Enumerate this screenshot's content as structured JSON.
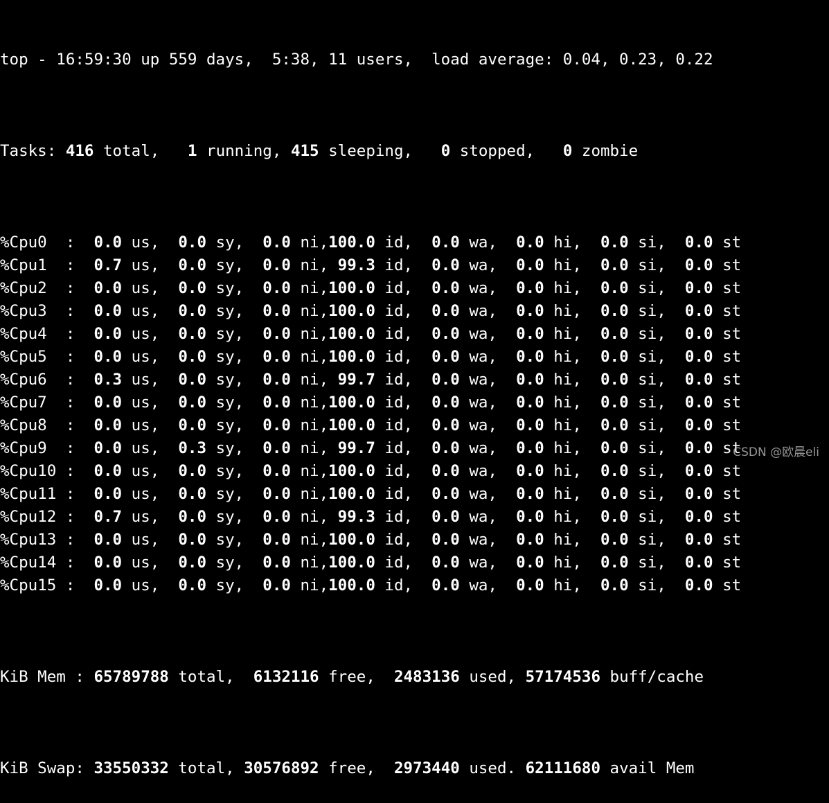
{
  "colors": {
    "background": "#000000",
    "foreground": "#ffffff"
  },
  "summary": {
    "uptime": "top - 16:59:30 up 559 days,  5:38, 11 users,  load average: 0.04, 0.23, 0.22",
    "tasks": {
      "label": "Tasks: ",
      "total": "416",
      "total_label": " total,   ",
      "running": "1",
      "running_label": " running, ",
      "sleeping": "415",
      "sleeping_label": " sleeping,   ",
      "stopped": "0",
      "stopped_label": " stopped,   ",
      "zombie": "0",
      "zombie_label": " zombie"
    }
  },
  "cpu_labels": {
    "us": " us, ",
    "sy": " sy, ",
    "ni": " ni,",
    "id": " id, ",
    "wa": " wa, ",
    "hi": " hi, ",
    "si": " si, ",
    "st": " st"
  },
  "cpus": [
    {
      "name": "%Cpu0  : ",
      "us": " 0.0",
      "sy": " 0.0",
      "ni": " 0.0",
      "id": "100.0",
      "wa": " 0.0",
      "hi": " 0.0",
      "si": " 0.0",
      "st": " 0.0"
    },
    {
      "name": "%Cpu1  : ",
      "us": " 0.7",
      "sy": " 0.0",
      "ni": " 0.0",
      "id": " 99.3",
      "wa": " 0.0",
      "hi": " 0.0",
      "si": " 0.0",
      "st": " 0.0"
    },
    {
      "name": "%Cpu2  : ",
      "us": " 0.0",
      "sy": " 0.0",
      "ni": " 0.0",
      "id": "100.0",
      "wa": " 0.0",
      "hi": " 0.0",
      "si": " 0.0",
      "st": " 0.0"
    },
    {
      "name": "%Cpu3  : ",
      "us": " 0.0",
      "sy": " 0.0",
      "ni": " 0.0",
      "id": "100.0",
      "wa": " 0.0",
      "hi": " 0.0",
      "si": " 0.0",
      "st": " 0.0"
    },
    {
      "name": "%Cpu4  : ",
      "us": " 0.0",
      "sy": " 0.0",
      "ni": " 0.0",
      "id": "100.0",
      "wa": " 0.0",
      "hi": " 0.0",
      "si": " 0.0",
      "st": " 0.0"
    },
    {
      "name": "%Cpu5  : ",
      "us": " 0.0",
      "sy": " 0.0",
      "ni": " 0.0",
      "id": "100.0",
      "wa": " 0.0",
      "hi": " 0.0",
      "si": " 0.0",
      "st": " 0.0"
    },
    {
      "name": "%Cpu6  : ",
      "us": " 0.3",
      "sy": " 0.0",
      "ni": " 0.0",
      "id": " 99.7",
      "wa": " 0.0",
      "hi": " 0.0",
      "si": " 0.0",
      "st": " 0.0"
    },
    {
      "name": "%Cpu7  : ",
      "us": " 0.0",
      "sy": " 0.0",
      "ni": " 0.0",
      "id": "100.0",
      "wa": " 0.0",
      "hi": " 0.0",
      "si": " 0.0",
      "st": " 0.0"
    },
    {
      "name": "%Cpu8  : ",
      "us": " 0.0",
      "sy": " 0.0",
      "ni": " 0.0",
      "id": "100.0",
      "wa": " 0.0",
      "hi": " 0.0",
      "si": " 0.0",
      "st": " 0.0"
    },
    {
      "name": "%Cpu9  : ",
      "us": " 0.0",
      "sy": " 0.3",
      "ni": " 0.0",
      "id": " 99.7",
      "wa": " 0.0",
      "hi": " 0.0",
      "si": " 0.0",
      "st": " 0.0"
    },
    {
      "name": "%Cpu10 : ",
      "us": " 0.0",
      "sy": " 0.0",
      "ni": " 0.0",
      "id": "100.0",
      "wa": " 0.0",
      "hi": " 0.0",
      "si": " 0.0",
      "st": " 0.0"
    },
    {
      "name": "%Cpu11 : ",
      "us": " 0.0",
      "sy": " 0.0",
      "ni": " 0.0",
      "id": "100.0",
      "wa": " 0.0",
      "hi": " 0.0",
      "si": " 0.0",
      "st": " 0.0"
    },
    {
      "name": "%Cpu12 : ",
      "us": " 0.7",
      "sy": " 0.0",
      "ni": " 0.0",
      "id": " 99.3",
      "wa": " 0.0",
      "hi": " 0.0",
      "si": " 0.0",
      "st": " 0.0"
    },
    {
      "name": "%Cpu13 : ",
      "us": " 0.0",
      "sy": " 0.0",
      "ni": " 0.0",
      "id": "100.0",
      "wa": " 0.0",
      "hi": " 0.0",
      "si": " 0.0",
      "st": " 0.0"
    },
    {
      "name": "%Cpu14 : ",
      "us": " 0.0",
      "sy": " 0.0",
      "ni": " 0.0",
      "id": "100.0",
      "wa": " 0.0",
      "hi": " 0.0",
      "si": " 0.0",
      "st": " 0.0"
    },
    {
      "name": "%Cpu15 : ",
      "us": " 0.0",
      "sy": " 0.0",
      "ni": " 0.0",
      "id": "100.0",
      "wa": " 0.0",
      "hi": " 0.0",
      "si": " 0.0",
      "st": " 0.0"
    }
  ],
  "memory": {
    "mem": {
      "label": "KiB Mem : ",
      "total": "65789788",
      "total_label": " total,  ",
      "free": "6132116",
      "free_label": " free,  ",
      "used": "2483136",
      "used_label": " used, ",
      "cache": "57174536",
      "cache_label": " buff/cache"
    },
    "swap": {
      "label": "KiB Swap: ",
      "total": "33550332",
      "total_label": " total, ",
      "free": "30576892",
      "free_label": " free,  ",
      "used": "2973440",
      "used_label": " used. ",
      "avail": "62111680",
      "avail_label": " avail Mem"
    }
  },
  "watermark": "CSDN @欧晨eli"
}
